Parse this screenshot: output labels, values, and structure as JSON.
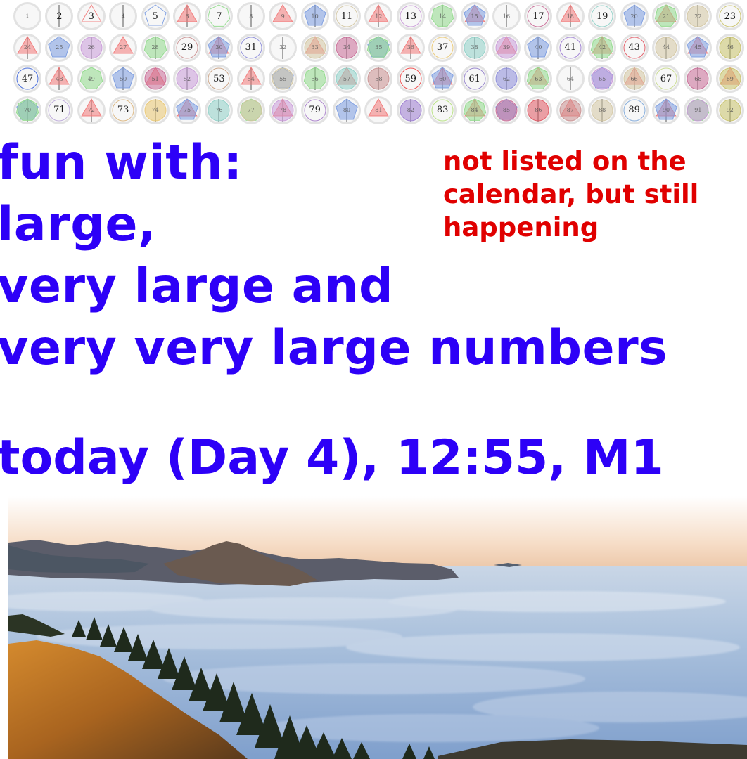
{
  "number_grid": {
    "rows": [
      [
        1,
        2,
        3,
        4,
        5,
        6,
        7,
        8,
        9,
        10,
        11,
        12,
        13,
        14,
        15,
        16,
        17,
        18,
        19,
        20,
        21,
        22,
        23
      ],
      [
        24,
        25,
        26,
        27,
        28,
        29,
        30,
        31,
        32,
        33,
        34,
        35,
        36,
        37,
        38,
        39,
        40,
        41,
        42,
        43,
        44,
        45,
        46
      ],
      [
        47,
        48,
        49,
        50,
        51,
        52,
        53,
        54,
        55,
        56,
        57,
        58,
        59,
        60,
        61,
        62,
        63,
        64,
        65,
        66,
        67,
        68,
        69
      ],
      [
        70,
        71,
        72,
        73,
        74,
        75,
        76,
        77,
        78,
        79,
        80,
        81,
        82,
        83,
        84,
        85,
        86,
        87,
        88,
        89,
        90,
        91,
        92
      ]
    ],
    "colors": {
      "2": "#f0d33a",
      "3": "#f27878",
      "5": "#7a9be0",
      "7": "#8fd98a",
      "11": "#d3c6a2",
      "13": "#c99ad8",
      "17": "#c86a96",
      "19": "#8ecfc7",
      "23": "#c9c26a",
      "29": "#c98e8e",
      "31": "#8a8ad8",
      "37": "#e9c770",
      "41": "#9a7ad0",
      "43": "#e05560",
      "47": "#3b63d8",
      "53": "#c89f7f",
      "59": "#ee4444",
      "61": "#8f7cc9",
      "67": "#c7d98a",
      "71": "#b9a5d8",
      "73": "#d9b37a",
      "79": "#a57ac9",
      "83": "#b3e07a",
      "89": "#7aa5d8"
    },
    "shape_names": {
      "2": "line-icon",
      "3": "triangle-icon",
      "4": "square-icon",
      "5": "pentagon-icon",
      "6": "hexagon-icon",
      "7": "heptagon-icon",
      "circle": "circle-icon"
    }
  },
  "headline": {
    "line1": "fun with:",
    "line2": "large,",
    "line3": "very large and",
    "line4": "very very large numbers"
  },
  "side_note": {
    "line1": "not listed on the",
    "line2": "calendar, but still",
    "line3": "happening"
  },
  "today": "today (Day 4), 12:55, M1",
  "colors": {
    "headline": "#2d00f7",
    "side_note": "#e00000"
  }
}
